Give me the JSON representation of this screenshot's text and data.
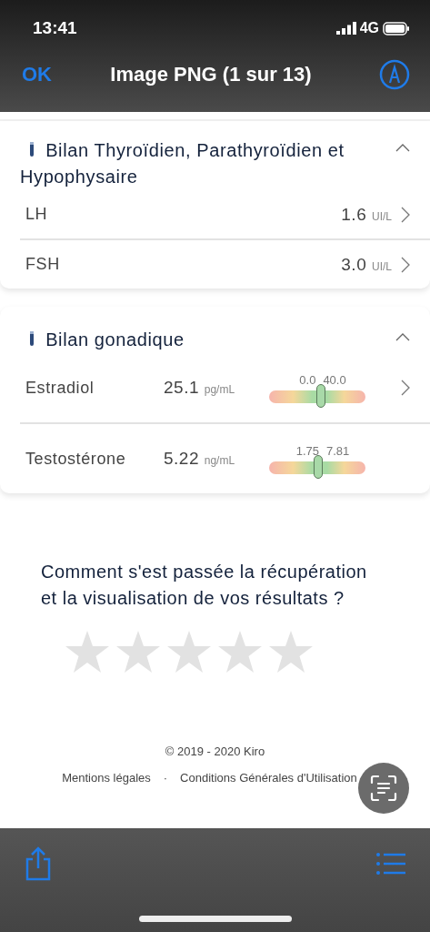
{
  "status_bar": {
    "time": "13:41",
    "network": "4G"
  },
  "nav": {
    "ok": "OK",
    "title": "Image PNG (1 sur 13)"
  },
  "sections": [
    {
      "title": "Bilan Thyroïdien, Parathyroïdien et Hypophysaire",
      "expanded": true,
      "rows": [
        {
          "kind": "simple",
          "name": "LH",
          "value": "1.6",
          "unit": "UI/L",
          "chevron": true
        },
        {
          "kind": "simple",
          "name": "FSH",
          "value": "3.0",
          "unit": "UI/L",
          "chevron": true
        }
      ]
    },
    {
      "title": "Bilan gonadique",
      "expanded": true,
      "rows": [
        {
          "kind": "range",
          "name": "Estradiol",
          "value": "25.1",
          "unit": "pg/mL",
          "low": "0.0",
          "high": "40.0",
          "level": 0.54,
          "chevron": true
        },
        {
          "kind": "range",
          "name": "Testostérone",
          "value": "5.22",
          "unit": "ng/mL",
          "low": "1.75",
          "high": "7.81",
          "level": 0.51,
          "chevron": false
        }
      ]
    }
  ],
  "rating": {
    "question": "Comment s'est passée la récupération et la visualisation de vos résultats ?",
    "stars": 0
  },
  "footer": {
    "copyright": "© 2019 - 2020 Kiro",
    "separator": "·",
    "links": [
      "Mentions légales",
      "Conditions Générales d'Utilisation"
    ]
  }
}
